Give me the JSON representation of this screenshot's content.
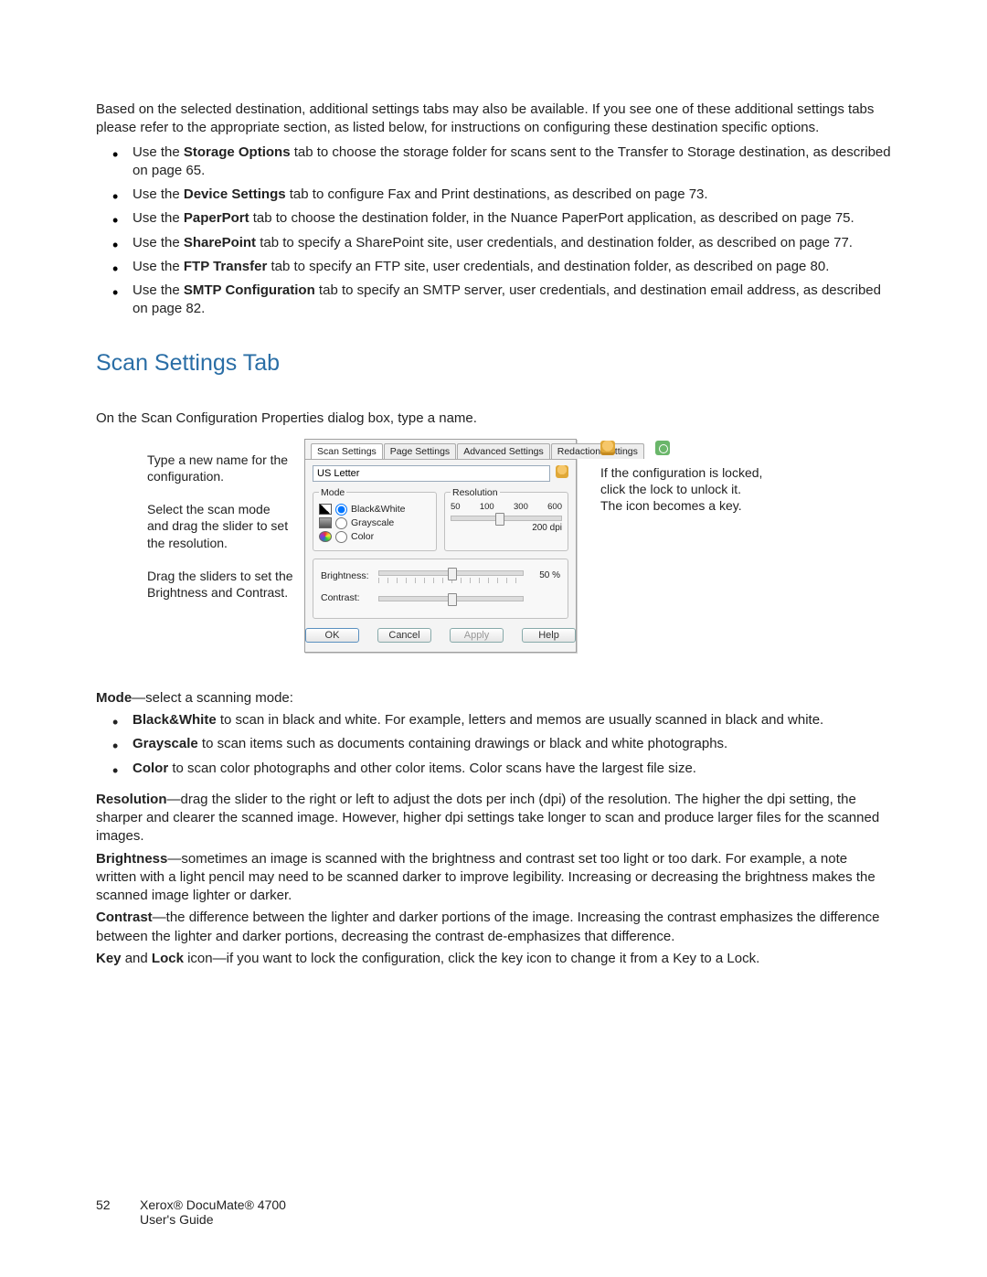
{
  "intro": {
    "p1": "Based on the selected destination, additional settings tabs may also be available. If you see one of these additional settings tabs please refer to the appropriate section, as listed below, for instructions on configuring these destination specific options."
  },
  "intro_list": [
    {
      "pre": "Use the ",
      "b": "Storage Options",
      "post": " tab to choose the storage folder for scans sent to the Transfer to Storage destination, as described on page 65."
    },
    {
      "pre": "Use the ",
      "b": "Device Settings",
      "post": " tab to configure Fax and Print destinations, as described on page 73."
    },
    {
      "pre": "Use the ",
      "b": "PaperPort",
      "post": " tab to choose the destination folder, in the Nuance PaperPort application, as described on page 75."
    },
    {
      "pre": "Use the ",
      "b": "SharePoint",
      "post": " tab to specify a SharePoint site, user credentials, and destination folder, as described on page 77."
    },
    {
      "pre": "Use the ",
      "b": "FTP Transfer",
      "post": " tab to specify an FTP site, user credentials, and destination folder, as described on page 80."
    },
    {
      "pre": "Use the ",
      "b": "SMTP Configuration",
      "post": " tab to specify an SMTP server, user credentials, and destination email address, as described on page 82."
    }
  ],
  "heading": "Scan Settings Tab",
  "heading_sub": "On the Scan Configuration Properties dialog box, type a name.",
  "left_notes": {
    "a": "Type a new name for the configuration.",
    "b": "Select the scan mode and drag the slider to set the resolution.",
    "c": "Drag the sliders to set the Brightness and Contrast."
  },
  "right_note": "If the configuration is locked, click the lock to unlock it. The icon becomes a key.",
  "dialog": {
    "tabs": [
      "Scan Settings",
      "Page Settings",
      "Advanced Settings",
      "Redaction Settings"
    ],
    "name_value": "US Letter",
    "mode_legend": "Mode",
    "modes": {
      "bw": "Black&White",
      "gray": "Grayscale",
      "color": "Color"
    },
    "res_legend": "Resolution",
    "res_ticks": [
      "50",
      "100",
      "300",
      "600"
    ],
    "res_value": "200 dpi",
    "brightness_label": "Brightness:",
    "brightness_value": "50 %",
    "contrast_label": "Contrast:",
    "buttons": {
      "ok": "OK",
      "cancel": "Cancel",
      "apply": "Apply",
      "help": "Help"
    }
  },
  "defs": {
    "mode_lead_b": "Mode",
    "mode_lead_post": "—select a scanning mode:",
    "mode_items": [
      {
        "b": "Black&White",
        "post": " to scan in black and white. For example, letters and memos are usually scanned in black and white."
      },
      {
        "b": "Grayscale",
        "post": " to scan items such as documents containing drawings or black and white photographs."
      },
      {
        "b": "Color",
        "post": " to scan color photographs and other color items. Color scans have the largest file size."
      }
    ],
    "resolution_b": "Resolution",
    "resolution_txt": "—drag the slider to the right or left to adjust the dots per inch (dpi) of the resolution. The higher the dpi setting, the sharper and clearer the scanned image. However, higher dpi settings take longer to scan and produce larger files for the scanned images.",
    "brightness_b": "Brightness",
    "brightness_txt": "—sometimes an image is scanned with the brightness and contrast set too light or too dark. For example, a note written with a light pencil may need to be scanned darker to improve legibility. Increasing or decreasing the brightness makes the scanned image lighter or darker.",
    "contrast_b": "Contrast",
    "contrast_txt": "—the difference between the lighter and darker portions of the image. Increasing the contrast emphasizes the difference between the lighter and darker portions, decreasing the contrast de-emphasizes that difference.",
    "keylock_b1": "Key",
    "keylock_mid": " and ",
    "keylock_b2": "Lock",
    "keylock_txt": " icon—if you want to lock the configuration, click the key icon to change it from a Key to a Lock."
  },
  "footer": {
    "page": "52",
    "line1": "Xerox® DocuMate® 4700",
    "line2": "User's Guide"
  }
}
